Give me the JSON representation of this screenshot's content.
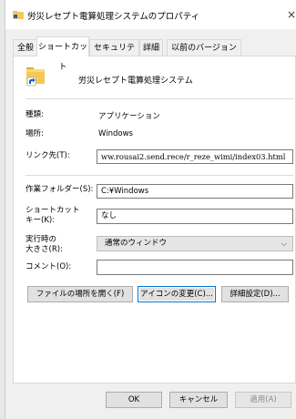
{
  "window": {
    "title": "労災レセプト電算処理システムのプロパティ",
    "close_glyph": "×",
    "icon": "shortcut-folder-icon"
  },
  "tabs": [
    {
      "label": "全般",
      "active": false
    },
    {
      "label": "ショートカット",
      "active": true
    },
    {
      "label": "セキュリティ",
      "active": false
    },
    {
      "label": "詳細",
      "active": false
    },
    {
      "label": "以前のバージョン",
      "active": false
    }
  ],
  "shortcut": {
    "app_icon": "folder-shortcut-icon",
    "name": "労災レセプト電算処理システム",
    "type_label": "種類:",
    "type_value": "アプリケーション",
    "location_label": "場所:",
    "location_value": "Windows",
    "target_label": "リンク先(T):",
    "target_value": "ww.rousai2.send.rece/r_reze_wimi/index03.html",
    "startin_label": "作業フォルダー(S):",
    "startin_value": "C:¥Windows",
    "hotkey_label_line1": "ショートカット",
    "hotkey_label_line2": "キー(K):",
    "hotkey_value": "なし",
    "run_label_line1": "実行時の",
    "run_label_line2": "大きさ(R):",
    "run_value": "通常のウィンドウ",
    "comment_label": "コメント(O):",
    "comment_value": ""
  },
  "buttons": {
    "open_location": "ファイルの場所を開く(F)",
    "change_icon": "アイコンの変更(C)...",
    "advanced": "詳細設定(D)...",
    "ok": "OK",
    "cancel": "キャンセル",
    "apply": "適用(A)"
  }
}
